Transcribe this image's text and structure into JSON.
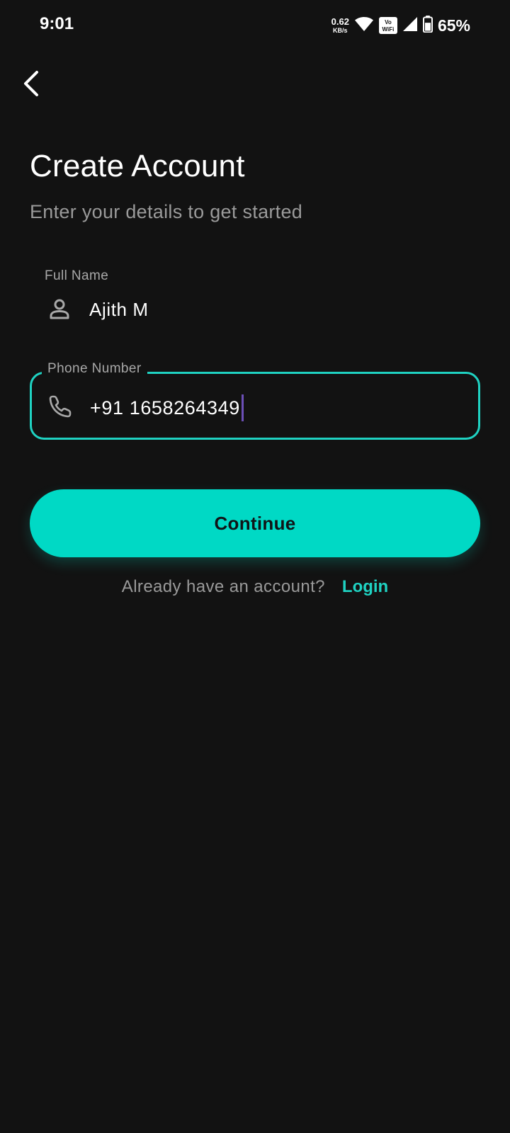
{
  "status_bar": {
    "time": "9:01",
    "net_speed_value": "0.62",
    "net_speed_unit": "KB/s",
    "vowifi_top": "Vo",
    "vowifi_bottom": "WiFi",
    "battery_percent": "65%",
    "battery_level": 0.65,
    "icons": [
      "wifi-icon",
      "vowifi-icon",
      "cell-signal-icon",
      "battery-icon"
    ]
  },
  "header": {
    "back_icon": "chevron-left-icon",
    "title": "Create Account",
    "subtitle": "Enter your details to get started"
  },
  "form": {
    "full_name": {
      "label": "Full Name",
      "value": "Ajith M",
      "icon": "person-icon",
      "focused": false
    },
    "phone": {
      "label": "Phone Number",
      "value": "+91 1658264349",
      "icon": "phone-icon",
      "focused": true
    }
  },
  "actions": {
    "continue_label": "Continue"
  },
  "login": {
    "prompt": "Already have an account?",
    "link_label": "Login"
  },
  "colors": {
    "background": "#121212",
    "accent": "#00d9c5",
    "muted_text": "#9a9a9a",
    "cursor": "#6c4fb6"
  }
}
